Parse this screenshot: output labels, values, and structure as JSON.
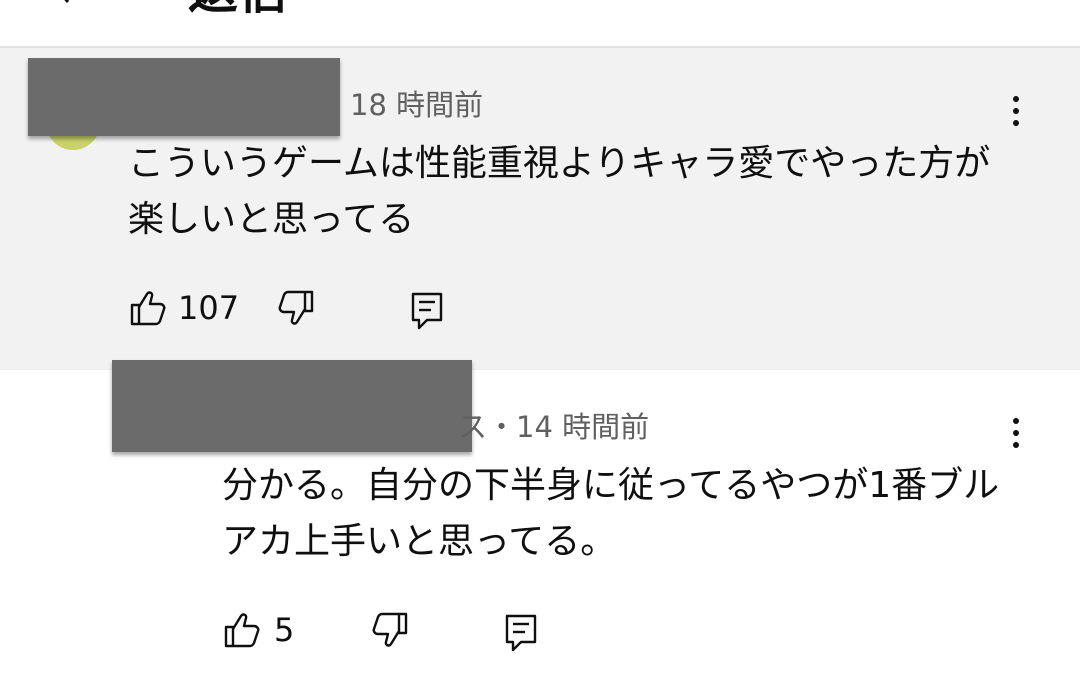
{
  "header": {
    "title": "返信",
    "back_icon": "chevron-left-icon",
    "close_icon": "close-icon"
  },
  "comment": {
    "timestamp": "18 時間前",
    "text": "こういうゲームは性能重視よりキャラ愛でやった方が楽しいと思ってる",
    "like_count": "107",
    "icons": [
      "thumbs-up-icon",
      "thumbs-down-icon",
      "reply-icon",
      "more-vert-icon"
    ]
  },
  "reply": {
    "author_fragment": "ス",
    "separator": "・",
    "timestamp": "14 時間前",
    "text": "分かる。自分の下半身に従ってるやつが1番ブルアカ上手いと思ってる。",
    "like_count": "5",
    "icons": [
      "thumbs-up-icon",
      "thumbs-down-icon",
      "reply-icon",
      "more-vert-icon"
    ]
  },
  "colors": {
    "highlight_bg": "#f2f2f2",
    "meta_text": "#606060",
    "redaction": "#6b6b6b"
  }
}
